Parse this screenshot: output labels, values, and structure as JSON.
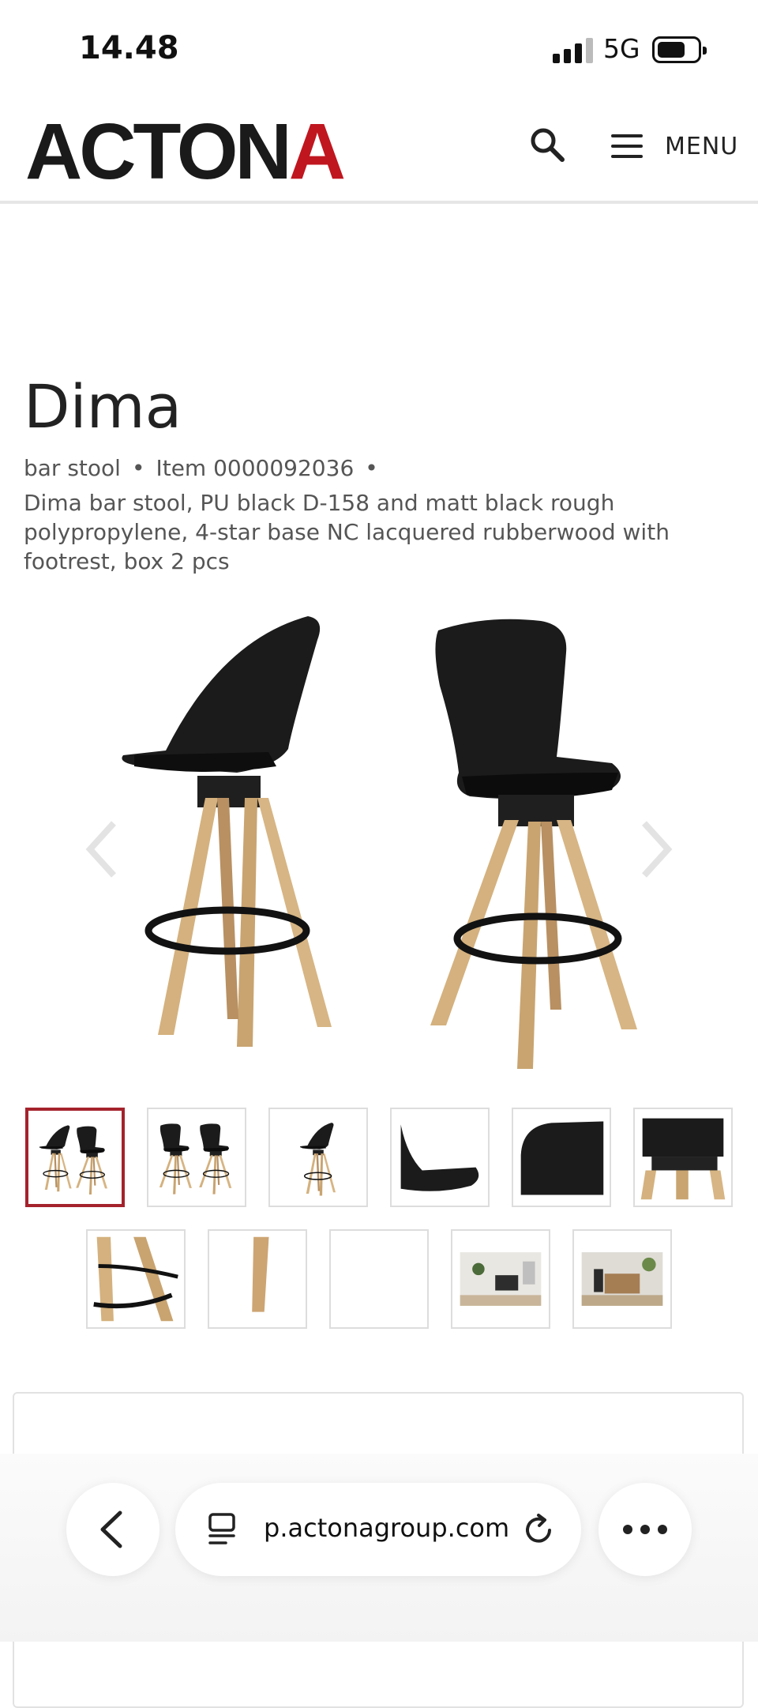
{
  "status_bar": {
    "time": "14.48",
    "network": "5G"
  },
  "header": {
    "logo_main": "ACTON",
    "logo_accent": "A",
    "menu_label": "MENU",
    "accent_color": "#c0161f"
  },
  "product": {
    "title": "Dima",
    "category": "bar stool",
    "item": "Item 0000092036",
    "bullet": "•",
    "description": "Dima bar stool, PU black D-158 and matt black rough polypropylene, 4-star base NC lacquered rubberwood with footrest, box 2 pcs"
  },
  "gallery": {
    "prev_icon": "chevron-left-icon",
    "next_icon": "chevron-right-icon",
    "thumbnail_count": 11,
    "active_thumbnail": 1,
    "active_border_color": "#a4222c"
  },
  "browser": {
    "url": "p.actonagroup.com",
    "back_icon": "chevron-left-icon",
    "tabs_icon": "tabs-icon",
    "reload_icon": "reload-icon",
    "more_icon": "more-icon"
  }
}
